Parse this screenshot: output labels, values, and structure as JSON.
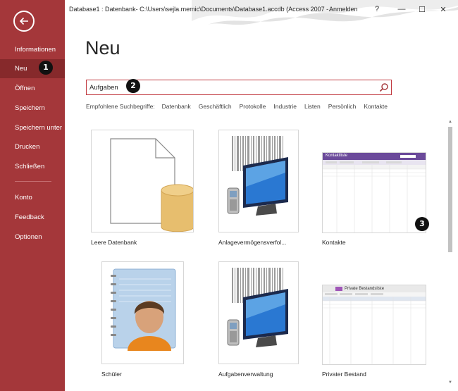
{
  "titlebar": {
    "title": "Database1 : Datenbank- C:\\Users\\sejla.memic\\Documents\\Database1.accdb (Access 2007 -...",
    "sign_in": "Anmelden",
    "help": "?",
    "minimize": "—",
    "restore": "☐",
    "close": "✕"
  },
  "sidebar": {
    "items": [
      {
        "label": "Informationen"
      },
      {
        "label": "Neu"
      },
      {
        "label": "Öffnen"
      },
      {
        "label": "Speichern"
      },
      {
        "label": "Speichern unter"
      },
      {
        "label": "Drucken"
      },
      {
        "label": "Schließen"
      },
      {
        "label": "Konto"
      },
      {
        "label": "Feedback"
      },
      {
        "label": "Optionen"
      }
    ],
    "active": "Neu",
    "accent": "#a4373a"
  },
  "main": {
    "title": "Neu",
    "search": {
      "value": "Aufgaben"
    },
    "suggestions": {
      "label": "Empfohlene Suchbegriffe:",
      "terms": [
        "Datenbank",
        "Geschäftlich",
        "Protokolle",
        "Industrie",
        "Listen",
        "Persönlich",
        "Kontakte"
      ]
    },
    "templates": [
      {
        "label": "Leere Datenbank"
      },
      {
        "label": "Anlagevermögensverfol..."
      },
      {
        "label": "Kontakte"
      },
      {
        "label": "Schüler"
      },
      {
        "label": "Aufgabenverwaltung"
      },
      {
        "label": "Privater Bestand"
      }
    ],
    "thumb_text": {
      "kontakte_title": "Kontaktliste",
      "bestand_title": "Private Bestandsliste"
    }
  },
  "callouts": [
    "1",
    "2",
    "3"
  ]
}
